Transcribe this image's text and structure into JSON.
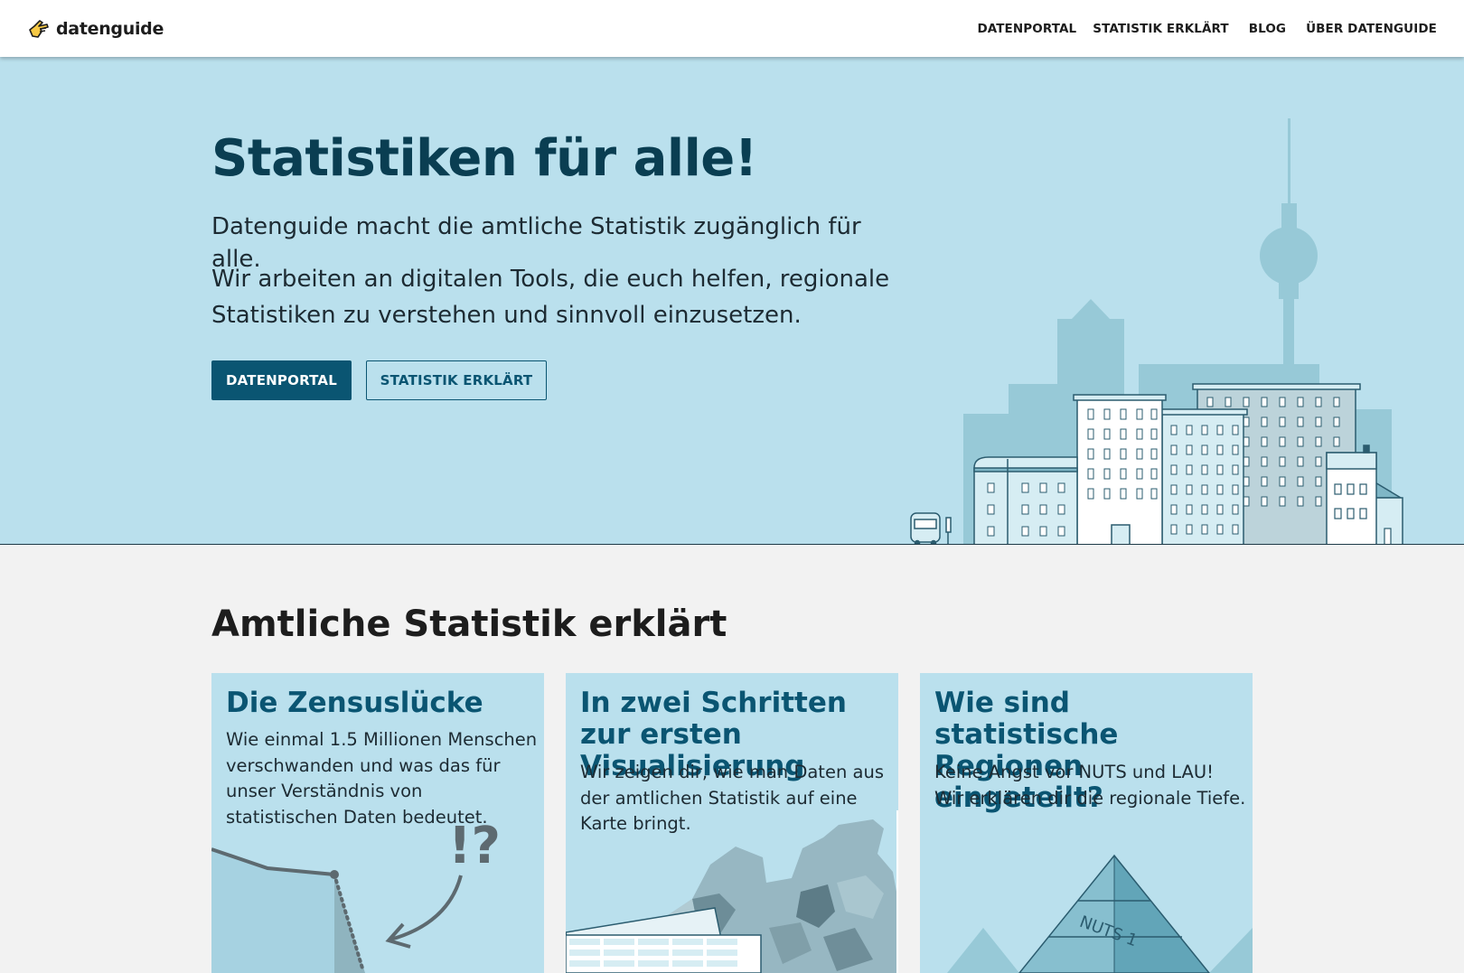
{
  "header": {
    "logo_text": "datenguide",
    "nav": [
      "DATENPORTAL",
      "STATISTIK ERKLÄRT",
      "BLOG",
      "ÜBER DATENGUIDE"
    ]
  },
  "hero": {
    "title": "Statistiken für alle!",
    "lead": "Datenguide macht die amtliche Statistik zugänglich für alle.",
    "sub": "Wir arbeiten an digitalen Tools, die euch helfen, regionale Statistiken zu verstehen und sinnvoll einzusetzen.",
    "primary_button": "DATENPORTAL",
    "secondary_button": "STATISTIK ERKLÄRT"
  },
  "section": {
    "title": "Amtliche Statistik erklärt",
    "cards": [
      {
        "title": "Die Zensuslücke",
        "text": "Wie einmal 1.5 Millionen Menschen verschwanden und was das für unser Verständnis von statistischen Daten bedeutet.",
        "art": "line-drop-illustration"
      },
      {
        "title": "In zwei Schritten zur ersten Visualisierung",
        "text": "Wir zeigen dir, wie man Daten aus der amtlichen Statistik auf eine Karte bringt.",
        "art": "map-table-illustration"
      },
      {
        "title": "Wie sind statistische Regionen eingeteilt?",
        "text": "Keine Angst vor NUTS und LAU! Wir erklären dir die regionale Tiefe.",
        "art": "pyramid-illustration",
        "art_label": "NUTS 1"
      }
    ]
  },
  "colors": {
    "hero_bg": "#bae0ed",
    "brand_dark": "#0a5572",
    "title_dark": "#0a3e52",
    "page_bg": "#f2f2f2"
  }
}
